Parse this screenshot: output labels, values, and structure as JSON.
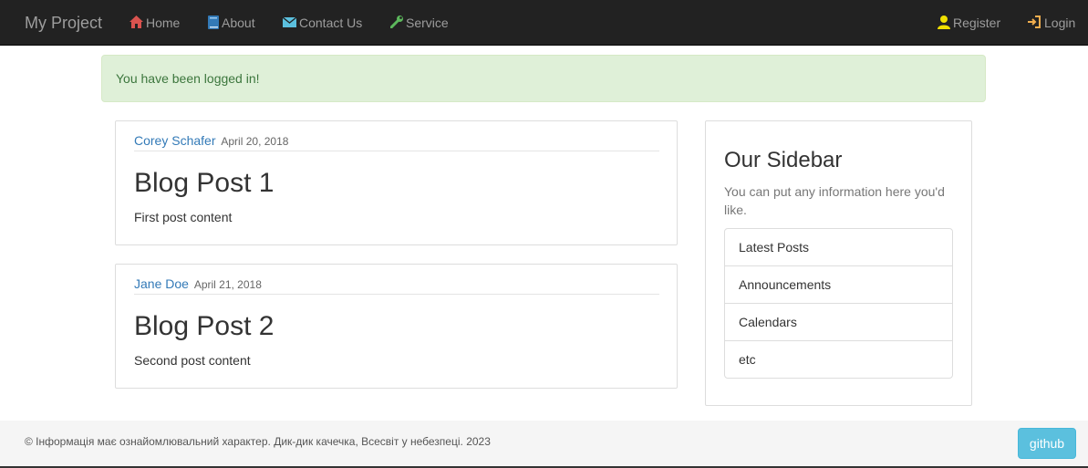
{
  "navbar": {
    "brand": "My Project",
    "links": [
      {
        "label": "Home",
        "icon": "home-icon",
        "icon_color": "#d9534f"
      },
      {
        "label": "About",
        "icon": "book-icon",
        "icon_color": "#337ab7"
      },
      {
        "label": "Contact Us",
        "icon": "envelope-icon",
        "icon_color": "#5bc0de"
      },
      {
        "label": "Service",
        "icon": "wrench-icon",
        "icon_color": "#5cb85c"
      }
    ],
    "right_links": [
      {
        "label": "Register",
        "icon": "user-icon",
        "icon_color": "#f0e000"
      },
      {
        "label": "Login",
        "icon": "log-in-icon",
        "icon_color": "#f0ad4e"
      }
    ]
  },
  "alert": {
    "message": "You have been logged in!",
    "type": "success"
  },
  "posts": [
    {
      "author": "Corey Schafer",
      "date": "April 20, 2018",
      "title": "Blog Post 1",
      "content": "First post content"
    },
    {
      "author": "Jane Doe",
      "date": "April 21, 2018",
      "title": "Blog Post 2",
      "content": "Second post content"
    }
  ],
  "sidebar": {
    "title": "Our Sidebar",
    "text": "You can put any information here you'd like.",
    "items": [
      "Latest Posts",
      "Announcements",
      "Calendars",
      "etc"
    ]
  },
  "footer": {
    "text": "© Інформація має ознайомлювальний характер. Дик-дик качечка, Всесвіт у небезпеці. 2023",
    "github_label": "github"
  },
  "colors": {
    "navbar_bg": "#222222",
    "link": "#337ab7",
    "alert_bg": "#dff0d8",
    "github_btn": "#5bc0de"
  }
}
